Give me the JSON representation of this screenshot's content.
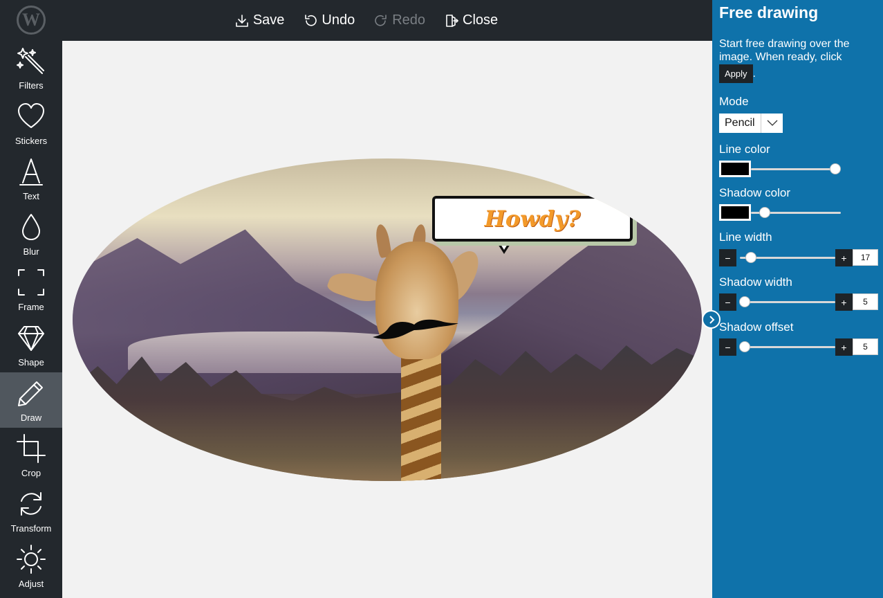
{
  "toolbar": {
    "save": "Save",
    "undo": "Undo",
    "redo": "Redo",
    "close": "Close"
  },
  "tools": [
    {
      "label": "Filters",
      "icon": "magic-wand-icon"
    },
    {
      "label": "Stickers",
      "icon": "heart-icon"
    },
    {
      "label": "Text",
      "icon": "text-a-icon"
    },
    {
      "label": "Blur",
      "icon": "droplet-icon"
    },
    {
      "label": "Frame",
      "icon": "frame-corners-icon"
    },
    {
      "label": "Shape",
      "icon": "diamond-icon"
    },
    {
      "label": "Draw",
      "icon": "pencil-icon",
      "active": true
    },
    {
      "label": "Crop",
      "icon": "crop-icon"
    },
    {
      "label": "Transform",
      "icon": "rotate-icon"
    },
    {
      "label": "Adjust",
      "icon": "sun-icon"
    }
  ],
  "canvas": {
    "bubble_text": "Howdy?"
  },
  "panel": {
    "title": "Free drawing",
    "description": "Start free drawing over the image. When ready, click",
    "apply_label": "Apply",
    "period": ".",
    "mode_label": "Mode",
    "mode_value": "Pencil",
    "line_color_label": "Line color",
    "line_color": "#000000",
    "shadow_color_label": "Shadow color",
    "shadow_color": "#000000",
    "line_width_label": "Line width",
    "line_width": "17",
    "shadow_width_label": "Shadow width",
    "shadow_width": "5",
    "shadow_offset_label": "Shadow offset",
    "shadow_offset": "5",
    "minus": "−",
    "plus": "+"
  },
  "colors": {
    "sidebar_bg": "#23282d",
    "panel_bg": "#0f72aa",
    "accent_text": "#f39a2a"
  }
}
